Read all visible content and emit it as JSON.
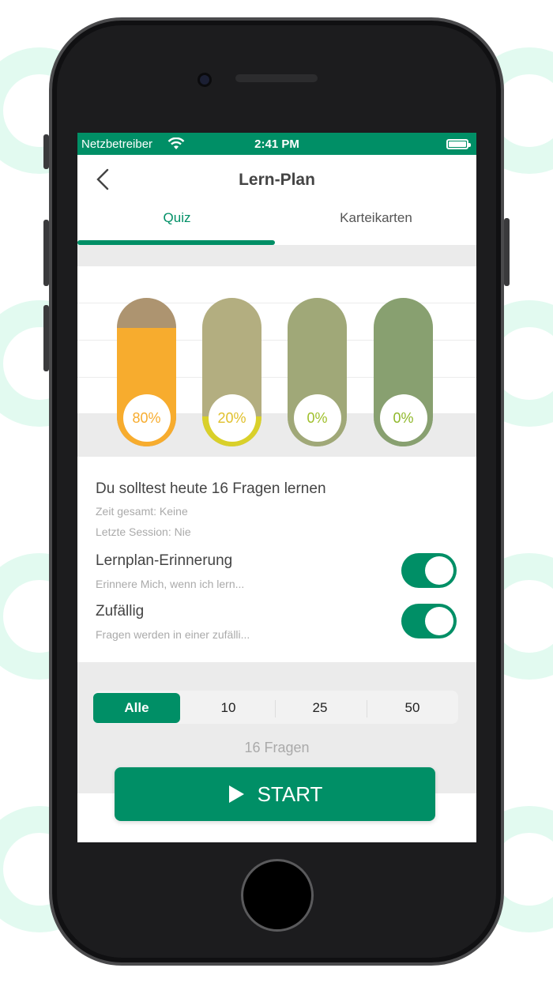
{
  "status_bar": {
    "carrier": "Netzbetreiber",
    "time": "2:41 PM"
  },
  "nav": {
    "title": "Lern-Plan",
    "back_icon": "chevron-left-icon"
  },
  "tabs": [
    {
      "label": "Quiz",
      "active": true
    },
    {
      "label": "Karteikarten",
      "active": false
    }
  ],
  "progress_pills": [
    {
      "label": "80%",
      "value": 0.8,
      "fill_color": "#f7ac2e",
      "track_color": "#ad9470",
      "text_color": "#f7ac2e"
    },
    {
      "label": "20%",
      "value": 0.2,
      "fill_color": "#d9d02a",
      "track_color": "#b3ae80",
      "text_color": "#e0c02c"
    },
    {
      "label": "0%",
      "value": 0.0,
      "fill_color": "#a0a878",
      "track_color": "#a0a878",
      "text_color": "#9fbf2a"
    },
    {
      "label": "0%",
      "value": 0.0,
      "fill_color": "#88a070",
      "track_color": "#88a070",
      "text_color": "#8fb82a"
    }
  ],
  "info": {
    "headline": "Du solltest heute 16 Fragen lernen",
    "total_time": "Zeit gesamt: Keine",
    "last_session": "Letzte Session: Nie"
  },
  "settings": [
    {
      "title": "Lernplan-Erinnerung",
      "description": "Erinnere Mich, wenn ich lern...",
      "on": true
    },
    {
      "title": "Zufällig",
      "description": "Fragen werden in einer zufälli...",
      "on": true
    }
  ],
  "question_count_options": [
    {
      "label": "Alle",
      "selected": true
    },
    {
      "label": "10",
      "selected": false
    },
    {
      "label": "25",
      "selected": false
    },
    {
      "label": "50",
      "selected": false
    }
  ],
  "question_count_label": "16 Fragen",
  "start_button": {
    "label": "START",
    "icon": "play-icon"
  },
  "colors": {
    "accent": "#008f66"
  }
}
